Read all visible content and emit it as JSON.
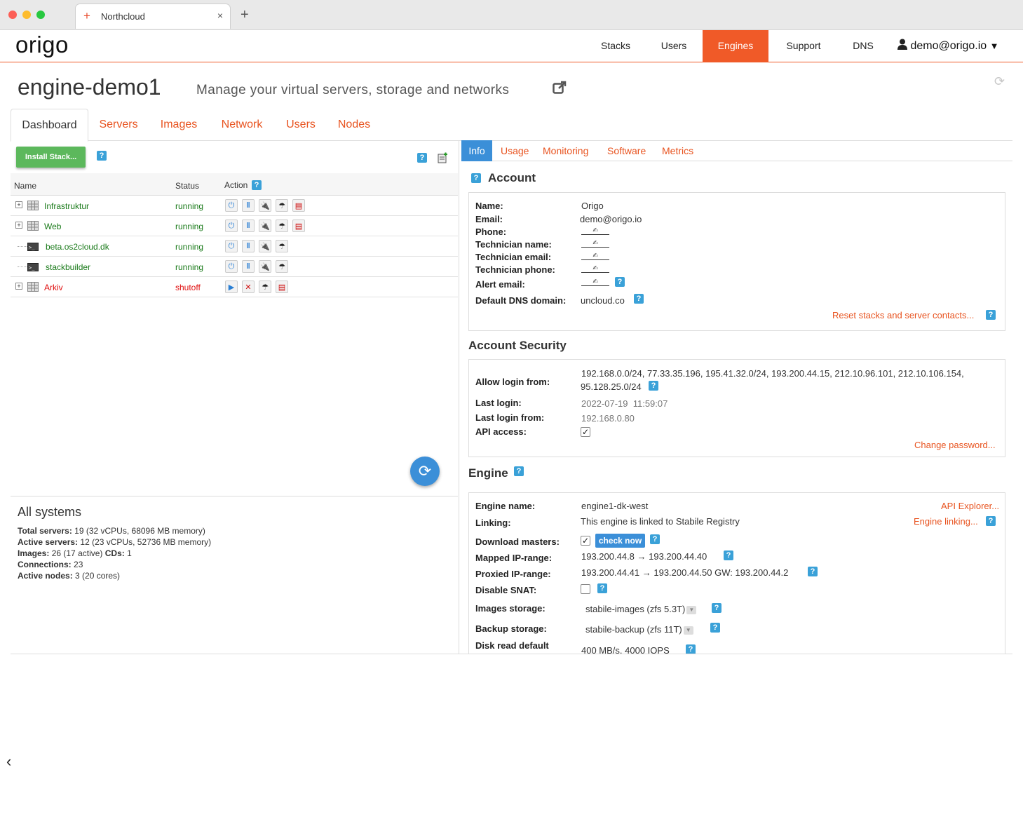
{
  "browser": {
    "tab_title": "Northcloud",
    "tab_close": "×",
    "new_tab": "+"
  },
  "nav": {
    "logo": "origo",
    "items": [
      "Stacks",
      "Users",
      "Engines",
      "Support",
      "DNS"
    ],
    "active": "Engines",
    "user": "demo@origo.io"
  },
  "header": {
    "title": "engine-demo1",
    "subtitle": "Manage your virtual servers, storage and networks"
  },
  "tabs": [
    "Dashboard",
    "Servers",
    "Images",
    "Network",
    "Users",
    "Nodes"
  ],
  "left": {
    "install_label": "Install Stack...",
    "columns": {
      "name": "Name",
      "status": "Status",
      "action": "Action"
    },
    "rows": [
      {
        "name": "Infrastruktur",
        "status": "running"
      },
      {
        "name": "Web",
        "status": "running"
      },
      {
        "name": "beta.os2cloud.dk",
        "status": "running"
      },
      {
        "name": "stackbuilder",
        "status": "running"
      },
      {
        "name": "Arkiv",
        "status": "shutoff"
      }
    ],
    "summary": {
      "title": "All systems",
      "total_label": "Total servers:",
      "total_value": "19 (32 vCPUs, 68096 MB memory)",
      "active_label": "Active servers:",
      "active_value": "12 (23 vCPUs, 52736 MB memory)",
      "images_label": "Images:",
      "images_value": "26 (17 active)",
      "cds_label": "CDs:",
      "cds_value": "1",
      "connections_label": "Connections:",
      "connections_value": "23",
      "nodes_label": "Active nodes:",
      "nodes_value": "3 (20 cores)"
    }
  },
  "right": {
    "subtabs": [
      "Info",
      "Usage",
      "Monitoring",
      "Software",
      "Metrics"
    ],
    "account": {
      "title": "Account",
      "name_label": "Name:",
      "name": "Origo",
      "email_label": "Email:",
      "email": "demo@origo.io",
      "phone_label": "Phone:",
      "tech_name_label": "Technician name:",
      "tech_email_label": "Technician email:",
      "tech_phone_label": "Technician phone:",
      "alert_label": "Alert email:",
      "dns_label": "Default DNS domain:",
      "dns": "uncloud.co",
      "reset_link": "Reset stacks and server contacts..."
    },
    "security": {
      "title": "Account Security",
      "allow_label": "Allow login from:",
      "allow_line1": "192.168.0.0/24, 77.33.35.196, 195.41.32.0/24, 193.200.44.15, 212.10.96.101, 212.10.106.154,",
      "allow_line2": "95.128.25.0/24",
      "last_login_label": "Last login:",
      "last_login": "2022-07-19  11:59:07",
      "last_from_label": "Last login from:",
      "last_from": "192.168.0.80",
      "api_label": "API access:",
      "api_checked": true,
      "change_pw": "Change password..."
    },
    "engine": {
      "title": "Engine",
      "name_label": "Engine name:",
      "name": "engine1-dk-west",
      "api_explorer": "API Explorer...",
      "linking_label": "Linking:",
      "linking": "This engine is linked to Stabile Registry",
      "engine_linking": "Engine linking...",
      "download_label": "Download masters:",
      "check_now": "check now",
      "mapped_label": "Mapped IP-range:",
      "mapped": "193.200.44.8 → 193.200.44.40",
      "proxied_label": "Proxied IP-range:",
      "proxied": "193.200.44.41 → 193.200.44.50 GW: 193.200.44.2",
      "snat_label": "Disable SNAT:",
      "images_label": "Images storage:",
      "images": "stabile-images (zfs 5.3T)",
      "backup_label": "Backup storage:",
      "backup": "stabile-backup (zfs 11T)",
      "disk_label": "Disk read default",
      "disk": "400 MB/s, 4000 IOPS"
    }
  },
  "colors": {
    "accent": "#f05a28",
    "link": "#e8531f",
    "running": "#1a8a1a",
    "shutoff": "#e01010",
    "info": "#3b8fd8",
    "help": "#3aa1d8",
    "install": "#5cb85c"
  }
}
